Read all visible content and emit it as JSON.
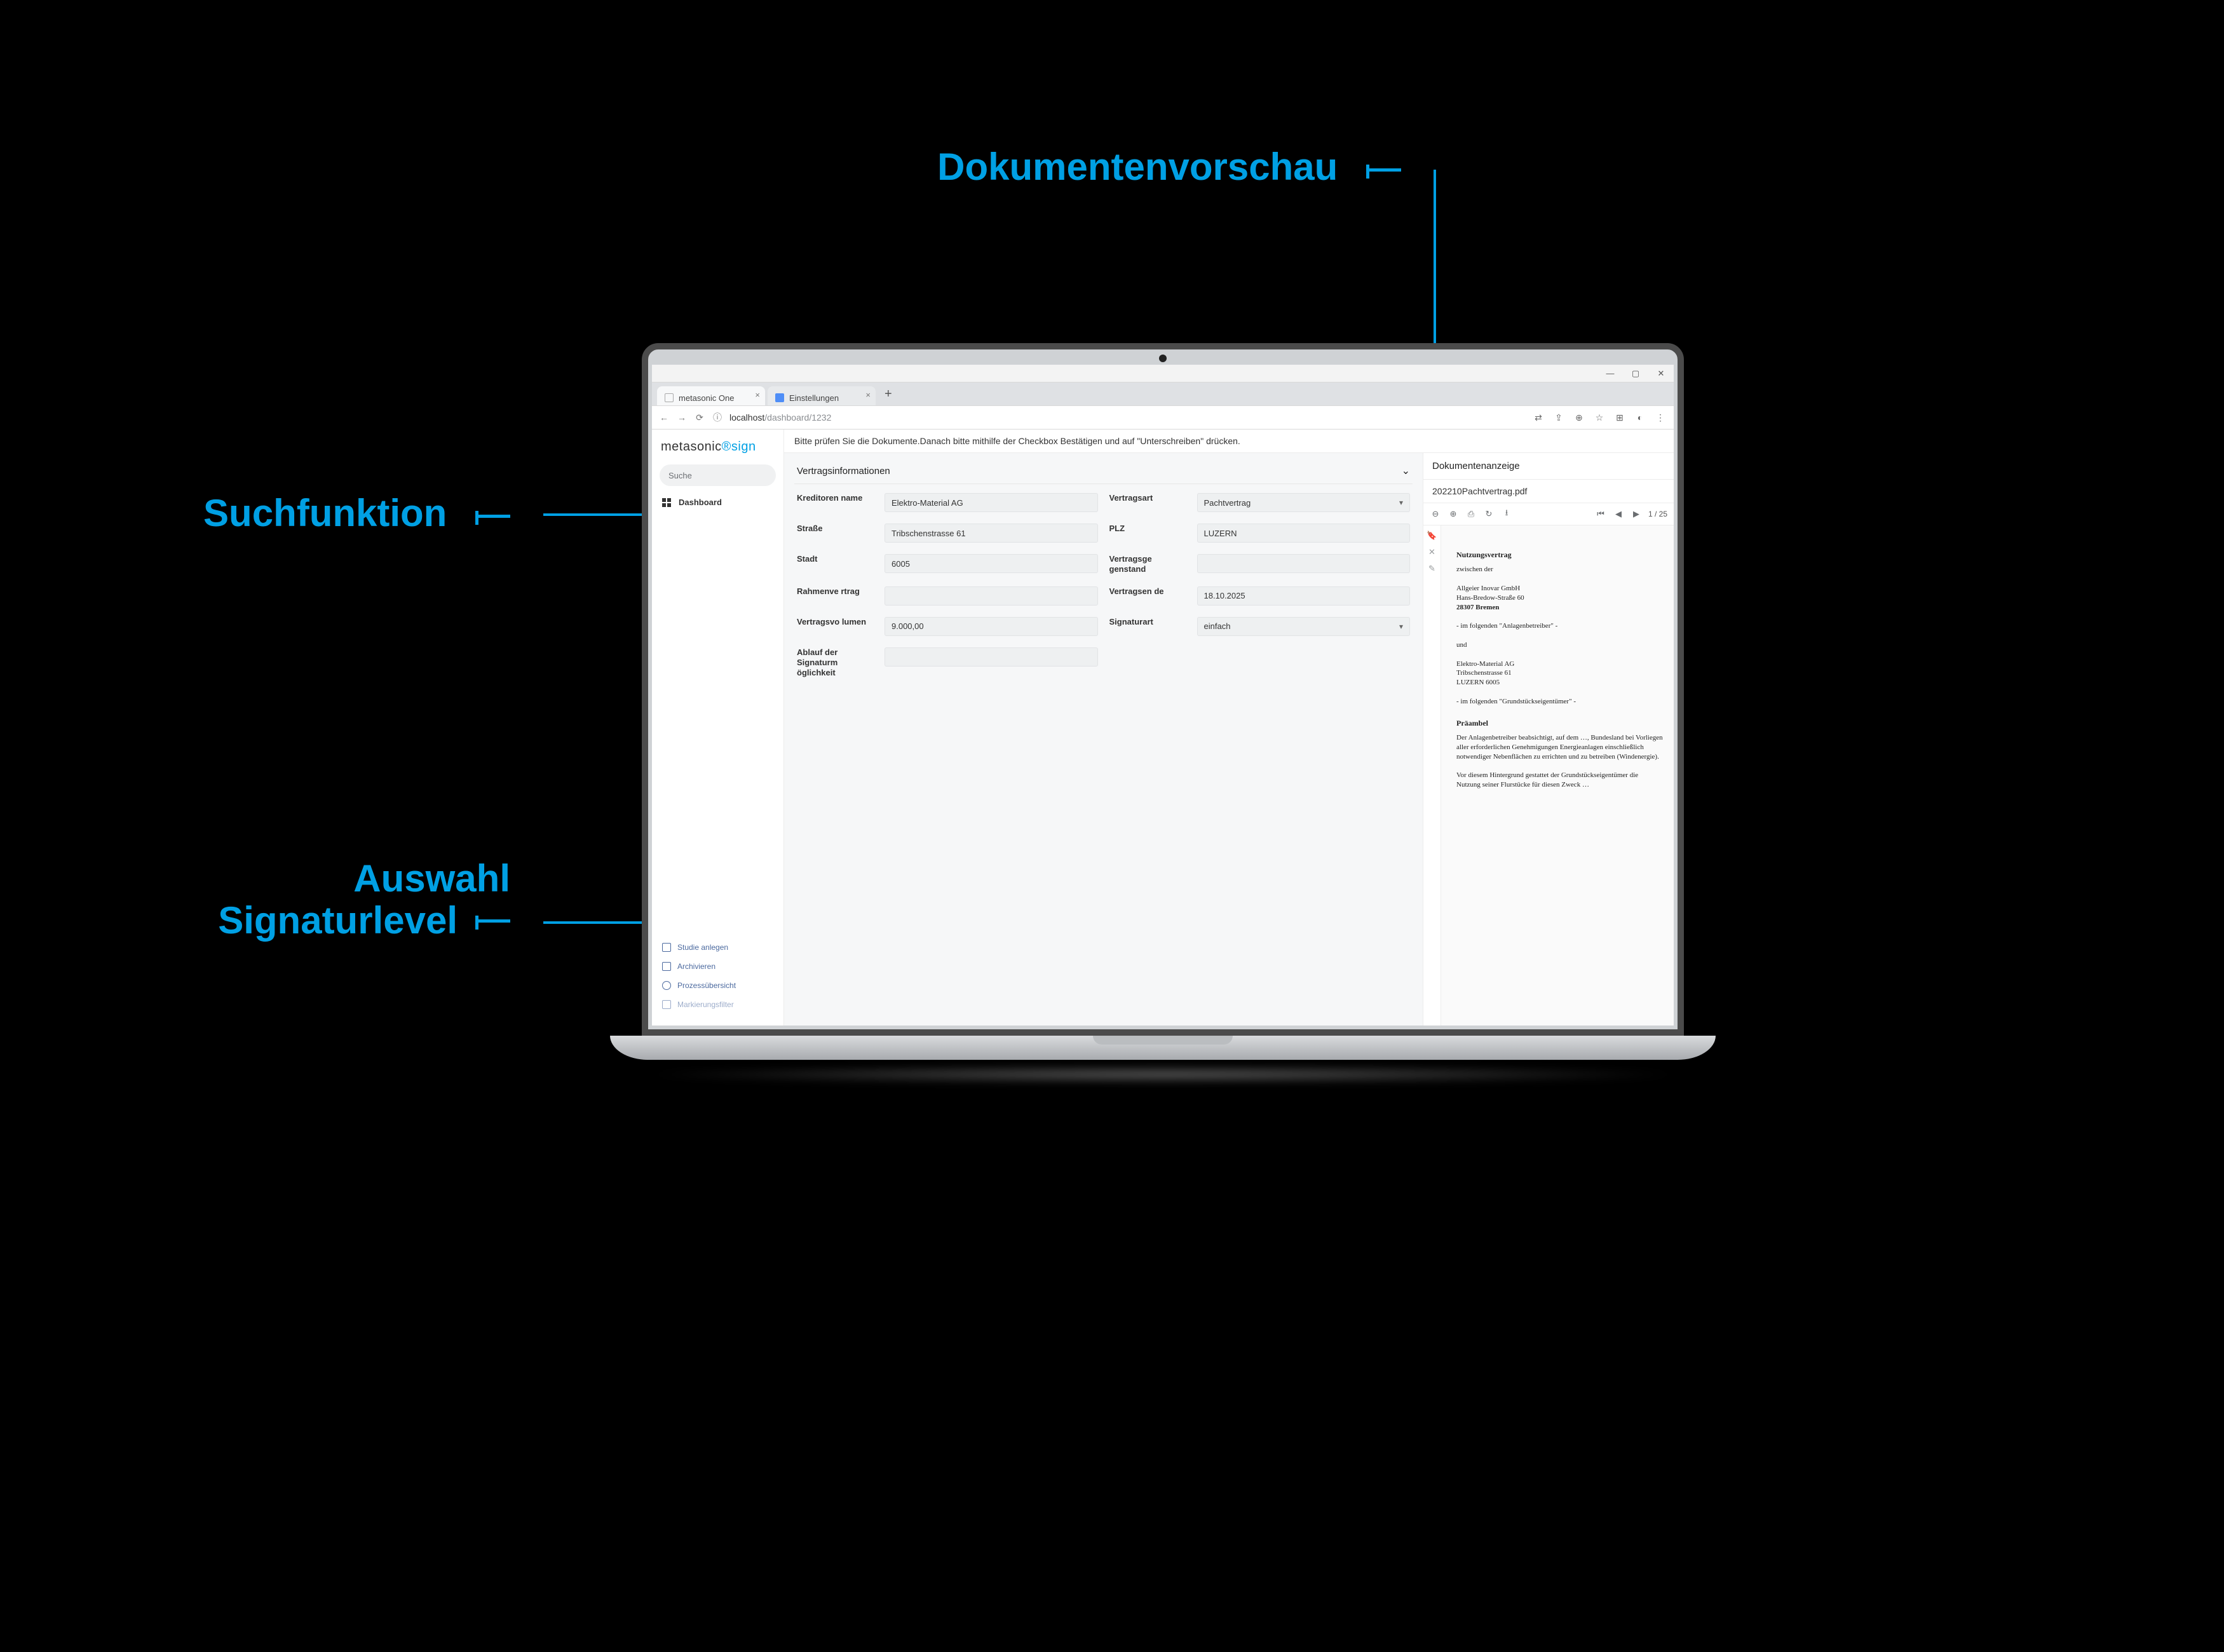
{
  "callouts": {
    "doc_preview": "Dokumentenvorschau",
    "search_fn": "Suchfunktion",
    "sig_level_1": "Auswahl",
    "sig_level_2": "Signaturlevel"
  },
  "browser": {
    "tab1": "metasonic One",
    "tab2": "Einstellungen",
    "url_host": "localhost",
    "url_path": "/dashboard/1232",
    "win_min": "—",
    "win_max": "▢",
    "win_close": "✕"
  },
  "brand": {
    "name": "metasonic",
    "suffix": "sign"
  },
  "sidebar": {
    "search_placeholder": "Suche",
    "dashboard": "Dashboard",
    "links": {
      "studie": "Studie anlegen",
      "archiv": "Archivieren",
      "prozess": "Prozessübersicht",
      "mark": "Markierungsfilter"
    }
  },
  "hint": "Bitte prüfen Sie die Dokumente.Danach bitte mithilfe der Checkbox Bestätigen und auf \"Unterschreiben\" drücken.",
  "form": {
    "panel_title": "Vertragsinformationen",
    "labels": {
      "kreditor": "Kreditoren name",
      "vertragsart": "Vertragsart",
      "strasse": "Straße",
      "plz": "PLZ",
      "stadt": "Stadt",
      "gegenstand": "Vertragsge genstand",
      "rahmen": "Rahmenve rtrag",
      "ende": "Vertragsen de",
      "volumen": "Vertragsvo lumen",
      "sigart": "Signaturart",
      "ablauf": "Ablauf der Signaturm öglichkeit"
    },
    "values": {
      "kreditor": "Elektro-Material AG",
      "vertragsart": "Pachtvertrag",
      "strasse": "Tribschenstrasse 61",
      "plz": "LUZERN",
      "stadt": "6005",
      "gegenstand": "",
      "rahmen": "",
      "ende": "18.10.2025",
      "volumen": "9.000,00",
      "sigart": "einfach",
      "ablauf": ""
    }
  },
  "doc": {
    "panel_title": "Dokumentenanzeige",
    "filename": "202210Pachtvertrag.pdf",
    "page": "1",
    "pages": "25",
    "sep": " / ",
    "content": {
      "title": "Nutzungsvertrag",
      "between": "zwischen der",
      "p1_l1": "Allgeier Inovar GmbH",
      "p1_l2": "Hans-Bredow-Straße 60",
      "p1_l3": "28307 Bremen",
      "role1_pre": "- im folgenden ",
      "role1_q": "\"Anlagenbetreiber\"",
      "role1_post": " -",
      "and": "und",
      "p2_l1": "Elektro-Material AG",
      "p2_l2": "Tribschenstrasse 61",
      "p2_l3": "LUZERN 6005",
      "role2_pre": "- im folgenden ",
      "role2_q": "\"Grundstückseigentümer\"",
      "role2_post": " -",
      "preamble_h": "Präambel",
      "pre1": "Der Anlagenbetreiber beabsichtigt, auf dem …, Bundesland bei Vorliegen aller erforderlichen Genehmigungen Energieanlagen einschließlich notwendiger Nebenflächen zu errichten und zu betreiben (Windenergie).",
      "pre2": "Vor diesem Hintergrund gestattet der Grundstückseigentümer die Nutzung seiner Flurstücke für diesen Zweck …"
    }
  }
}
